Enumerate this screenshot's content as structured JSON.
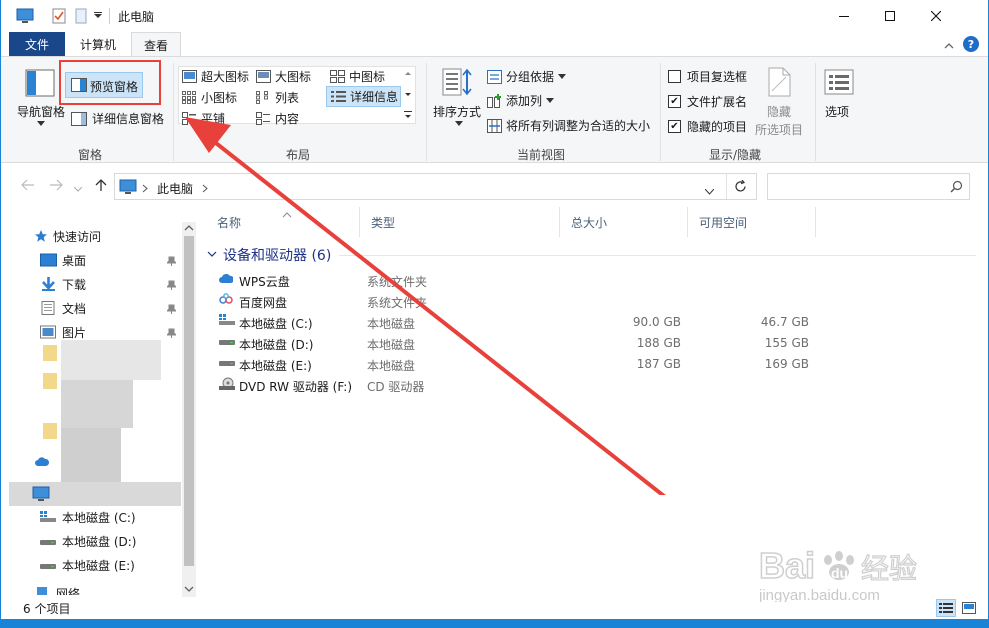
{
  "window": {
    "title": "此电脑"
  },
  "tabs": {
    "file": "文件",
    "computer": "计算机",
    "view": "查看"
  },
  "ribbon": {
    "pane": {
      "nav_pane": "导航窗格",
      "preview_pane": "预览窗格",
      "details_pane": "详细信息窗格",
      "group": "窗格"
    },
    "layout": {
      "extra_large": "超大图标",
      "large": "大图标",
      "medium": "中图标",
      "small": "小图标",
      "list": "列表",
      "details": "详细信息",
      "tiles": "平铺",
      "content": "内容",
      "group": "布局"
    },
    "current_view": {
      "sort_by": "排序方式",
      "group_by": "分组依据",
      "add_columns": "添加列",
      "size_all": "将所有列调整为合适的大小",
      "group": "当前视图"
    },
    "show_hide": {
      "item_checkboxes": "项目复选框",
      "file_extensions": "文件扩展名",
      "hidden_items": "隐藏的项目",
      "hide_selected_1": "隐藏",
      "hide_selected_2": "所选项目",
      "group": "显示/隐藏",
      "checks": {
        "item_checkboxes": false,
        "file_extensions": true,
        "hidden_items": true
      }
    },
    "options": "选项"
  },
  "address": {
    "path": "此电脑"
  },
  "nav": {
    "quick_access": "快速访问",
    "items": [
      "桌面",
      "下载",
      "文档",
      "图片"
    ],
    "drives": [
      "本地磁盘 (C:)",
      "本地磁盘 (D:)",
      "本地磁盘 (E:)"
    ],
    "network": "网络"
  },
  "columns": {
    "name": "名称",
    "type": "类型",
    "total": "总大小",
    "free": "可用空间"
  },
  "group_heading": "设备和驱动器 (6)",
  "rows": [
    {
      "name": "WPS云盘",
      "type": "系统文件夹",
      "total": "",
      "free": ""
    },
    {
      "name": "百度网盘",
      "type": "系统文件夹",
      "total": "",
      "free": ""
    },
    {
      "name": "本地磁盘 (C:)",
      "type": "本地磁盘",
      "total": "90.0 GB",
      "free": "46.7 GB"
    },
    {
      "name": "本地磁盘 (D:)",
      "type": "本地磁盘",
      "total": "188 GB",
      "free": "155 GB"
    },
    {
      "name": "本地磁盘 (E:)",
      "type": "本地磁盘",
      "total": "187 GB",
      "free": "169 GB"
    },
    {
      "name": "DVD RW 驱动器 (F:)",
      "type": "CD 驱动器",
      "total": "",
      "free": ""
    }
  ],
  "status": {
    "count": "6 个项目"
  },
  "watermark": {
    "brand": "Bai",
    "brand2": "du",
    "brand3": "经验",
    "url": "jingyan.baidu.com"
  },
  "colors": {
    "accent": "#1883d7",
    "file_tab": "#19478a",
    "annotation": "#e8403a",
    "group_heading": "#1e3287"
  }
}
